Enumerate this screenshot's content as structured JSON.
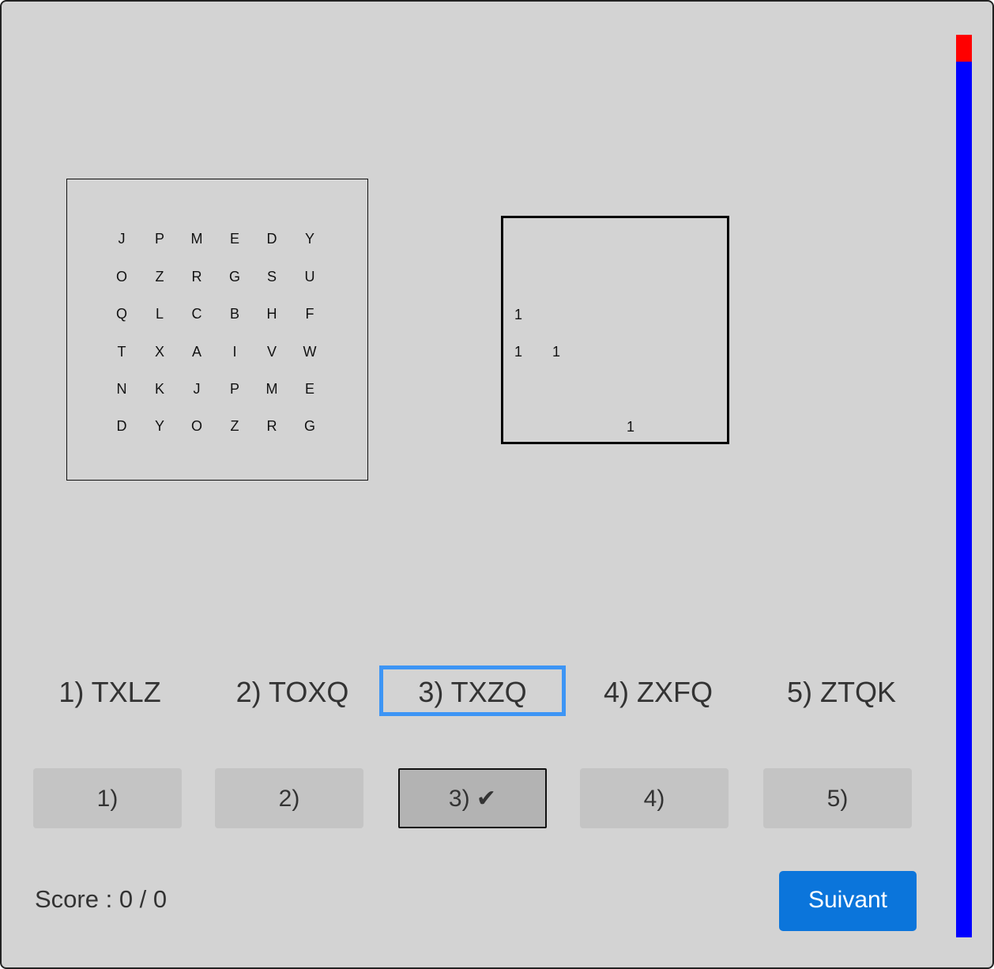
{
  "letter_grid": [
    [
      "J",
      "P",
      "M",
      "E",
      "D",
      "Y"
    ],
    [
      "O",
      "Z",
      "R",
      "G",
      "S",
      "U"
    ],
    [
      "Q",
      "L",
      "C",
      "B",
      "H",
      "F"
    ],
    [
      "T",
      "X",
      "A",
      "I",
      "V",
      "W"
    ],
    [
      "N",
      "K",
      "J",
      "P",
      "M",
      "E"
    ],
    [
      "D",
      "Y",
      "O",
      "Z",
      "R",
      "G"
    ]
  ],
  "answer_grid": [
    [
      "",
      "",
      "",
      "",
      "",
      ""
    ],
    [
      "",
      "",
      "",
      "",
      "",
      ""
    ],
    [
      "1",
      "",
      "",
      "",
      "",
      ""
    ],
    [
      "1",
      "1",
      "",
      "",
      "",
      ""
    ],
    [
      "",
      "",
      "",
      "",
      "",
      ""
    ],
    [
      "",
      "",
      "",
      "1",
      "",
      ""
    ]
  ],
  "options": [
    {
      "label": "1) TXLZ",
      "selected": false
    },
    {
      "label": "2) TOXQ",
      "selected": false
    },
    {
      "label": "3) TXZQ",
      "selected": true
    },
    {
      "label": "4) ZXFQ",
      "selected": false
    },
    {
      "label": "5) ZTQK",
      "selected": false
    }
  ],
  "choices": [
    {
      "label": "1)",
      "active": false
    },
    {
      "label": "2)",
      "active": false
    },
    {
      "label": "3) ✔",
      "active": true
    },
    {
      "label": "4)",
      "active": false
    },
    {
      "label": "5)",
      "active": false
    }
  ],
  "score": {
    "label": "Score : 0 / 0"
  },
  "next_button": {
    "label": "Suivant"
  },
  "timer": {
    "elapsed_fraction": 0.03,
    "elapsed_color": "#ff0000",
    "remaining_color": "#0000ff"
  }
}
